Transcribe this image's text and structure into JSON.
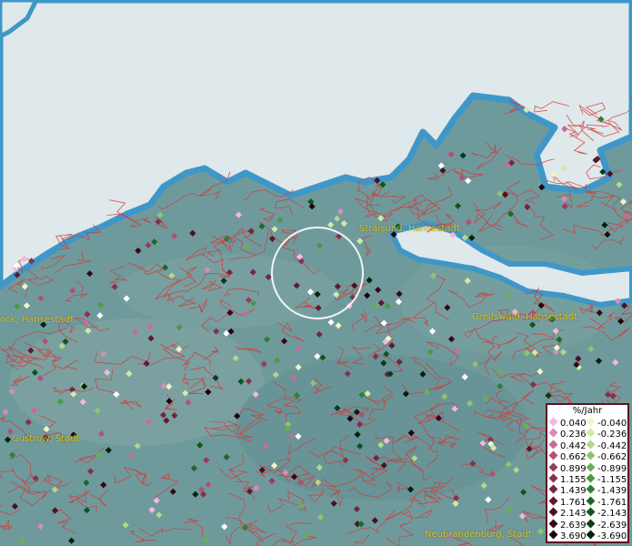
{
  "map": {
    "cities": [
      {
        "id": "rostock",
        "label": "ock, Hansestadt"
      },
      {
        "id": "stralsund",
        "label": "Stralsund, Hansestadt"
      },
      {
        "id": "greifswald",
        "label": "Greifswald, Hansestadt"
      },
      {
        "id": "guestrow",
        "label": "Gustrow, Stadt"
      },
      {
        "id": "neubrandenburg",
        "label": "Neubrandenburg, Stadt"
      }
    ],
    "colors": {
      "water": "#dfe8ea",
      "coast": "#3f97c8",
      "land": "#6f9a9c",
      "borders": "#d23a3a",
      "focus_ring": "#ffffff"
    }
  },
  "legend": {
    "title": "%/Jahr",
    "positive": [
      {
        "label": "0.040",
        "color": "#f2b8e0"
      },
      {
        "label": "0.236",
        "color": "#d98cba"
      },
      {
        "label": "0.442",
        "color": "#c76b98"
      },
      {
        "label": "0.662",
        "color": "#b35079"
      },
      {
        "label": "0.899",
        "color": "#9a3a5e"
      },
      {
        "label": "1.155",
        "color": "#86314e"
      },
      {
        "label": "1.439",
        "color": "#732640"
      },
      {
        "label": "1.761",
        "color": "#5e1a31"
      },
      {
        "label": "2.143",
        "color": "#4a1023"
      },
      {
        "label": "2.639",
        "color": "#360817"
      },
      {
        "label": "3.690",
        "color": "#22030c"
      }
    ],
    "negative": [
      {
        "label": "-0.040",
        "color": "#eef5c8"
      },
      {
        "label": "-0.236",
        "color": "#d3eaa6"
      },
      {
        "label": "-0.442",
        "color": "#b2d88a"
      },
      {
        "label": "-0.662",
        "color": "#8fc46e"
      },
      {
        "label": "-0.899",
        "color": "#6aaf56"
      },
      {
        "label": "-1.155",
        "color": "#4a9a45"
      },
      {
        "label": "-1.439",
        "color": "#2f8037"
      },
      {
        "label": "-1.761",
        "color": "#1c6a2a"
      },
      {
        "label": "-2.143",
        "color": "#0f5520"
      },
      {
        "label": "-2.639",
        "color": "#073d16"
      },
      {
        "label": "-3.690",
        "color": "#02230a"
      }
    ]
  }
}
